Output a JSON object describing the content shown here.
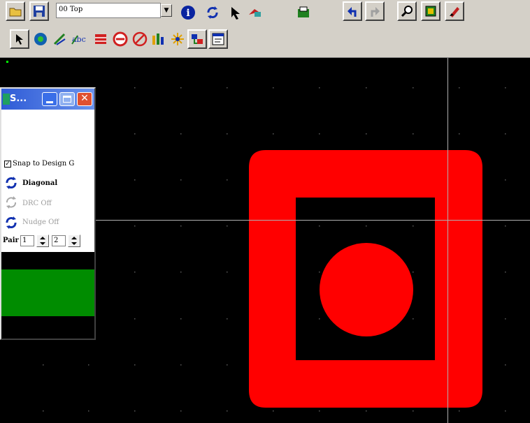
{
  "toolbar": {
    "layer_combo_value": "00 Top"
  },
  "panel": {
    "title": "S...",
    "snap_label": "Snap to Design G",
    "snap_checked": true,
    "diagonal_label": "Diagonal",
    "drc_label": "DRC Off",
    "nudge_label": "Nudge Off",
    "pair_label": "Pair",
    "pair_value_1": "1",
    "pair_value_2": "2",
    "swatch_color": "#008c00"
  },
  "canvas": {
    "background": "#000000",
    "pad_color": "#ff0000",
    "grid_color": "#5a5a5a",
    "cursor_color": "#b0b0b0"
  },
  "icons": {
    "row1": [
      "open-folder-icon",
      "save-icon",
      "combo-dropdown-icon",
      "info-icon",
      "refresh-icon",
      "select-arrow-icon",
      "route-icon",
      "component-icon",
      "undo-icon",
      "redo-icon",
      "zoom-icon",
      "board-icon",
      "paint-icon"
    ],
    "row2": [
      "select-icon",
      "pad-icon",
      "trace-icon",
      "text-abc-icon",
      "copper-pour-icon",
      "no-entry-icon",
      "prohibit-icon",
      "parts-icon",
      "connection-icon",
      "net-icon",
      "properties-icon"
    ]
  }
}
